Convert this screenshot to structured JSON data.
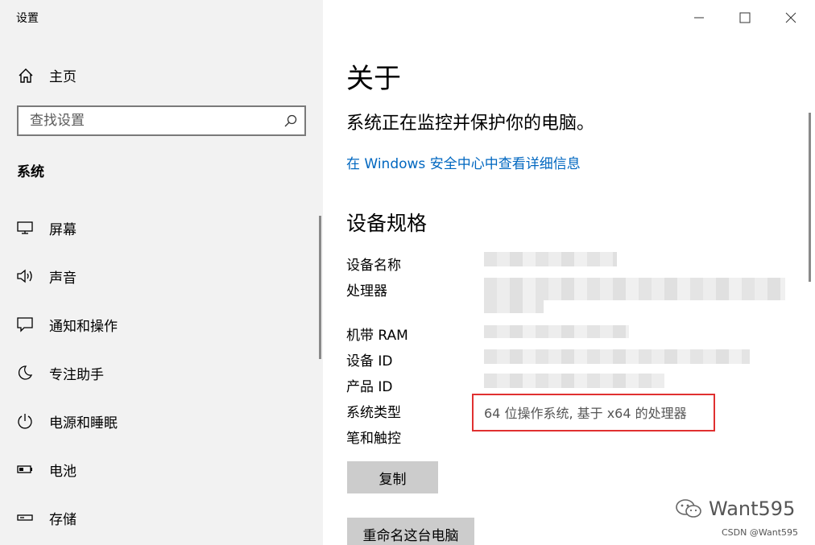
{
  "window": {
    "title": "设置",
    "controls": {
      "minimize": "minimize-icon",
      "maximize": "maximize-icon",
      "close": "close-icon"
    }
  },
  "sidebar": {
    "home": {
      "label": "主页",
      "icon": "home-icon"
    },
    "search": {
      "placeholder": "查找设置",
      "icon": "search-icon"
    },
    "section_title": "系统",
    "items": [
      {
        "label": "屏幕",
        "icon": "display-icon"
      },
      {
        "label": "声音",
        "icon": "sound-icon"
      },
      {
        "label": "通知和操作",
        "icon": "notification-icon"
      },
      {
        "label": "专注助手",
        "icon": "moon-icon"
      },
      {
        "label": "电源和睡眠",
        "icon": "power-icon"
      },
      {
        "label": "电池",
        "icon": "battery-icon"
      },
      {
        "label": "存储",
        "icon": "storage-icon"
      }
    ]
  },
  "main": {
    "title": "关于",
    "status": "系统正在监控并保护你的电脑。",
    "security_link": "在 Windows 安全中心中查看详细信息",
    "specs_heading": "设备规格",
    "specs": [
      {
        "label": "设备名称",
        "value": ""
      },
      {
        "label": "处理器",
        "value": ""
      },
      {
        "label": "机带 RAM",
        "value": ""
      },
      {
        "label": "设备 ID",
        "value": ""
      },
      {
        "label": "产品 ID",
        "value": ""
      },
      {
        "label": "系统类型",
        "value": "64 位操作系统, 基于 x64 的处理器"
      },
      {
        "label": "笔和触控",
        "value": ""
      }
    ],
    "copy_button": "复制",
    "rename_button": "重命名这台电脑"
  },
  "watermark": {
    "text": "Want595",
    "csdn": "CSDN @Want595"
  },
  "colors": {
    "accent": "#0067c0",
    "sidebar_bg": "#f2f2f2",
    "button_bg": "#cccccc",
    "highlight": "#e03030"
  }
}
